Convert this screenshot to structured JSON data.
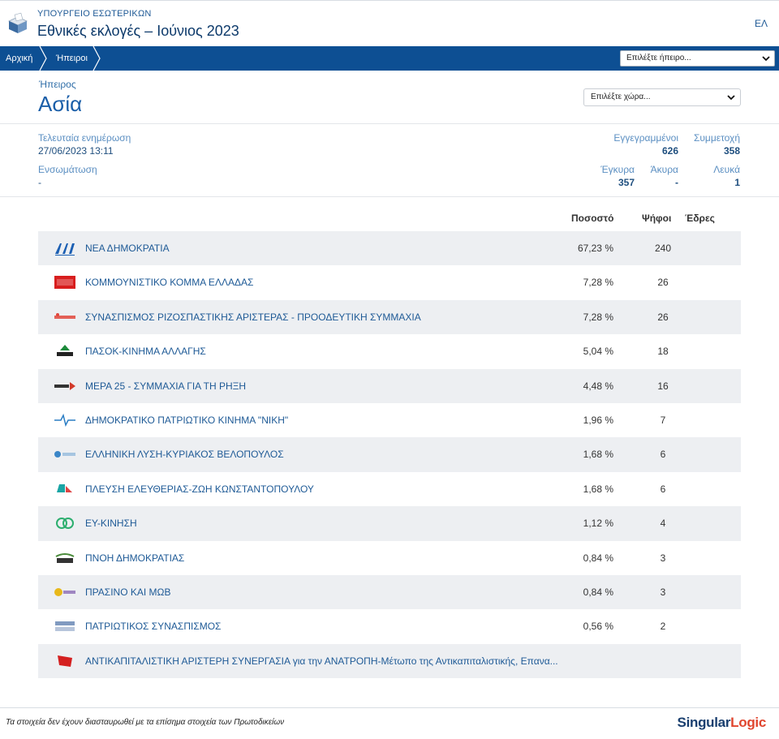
{
  "header": {
    "ministry": "ΥΠΟΥΡΓΕΙΟ ΕΣΩΤΕΡΙΚΩΝ",
    "title": "Εθνικές εκλογές – Ιούνιος 2023",
    "lang": "ΕΛ",
    "logo_icon": "ballot-box-icon"
  },
  "nav": {
    "crumbs": [
      "Αρχική",
      "Ήπειροι"
    ],
    "continent_select": "Επιλέξτε ήπειρο..."
  },
  "region": {
    "kicker": "Ήπειρος",
    "name": "Ασία",
    "country_select": "Επιλέξτε χώρα..."
  },
  "info": {
    "last_update_label": "Τελευταία ενημέρωση",
    "last_update_value": "27/06/2023 13:11",
    "integration_label": "Ενσωμάτωση",
    "integration_value": "-",
    "registered_label": "Εγγεγραμμένοι",
    "registered_value": "626",
    "turnout_label": "Συμμετοχή",
    "turnout_value": "358",
    "valid_label": "Έγκυρα",
    "valid_value": "357",
    "invalid_label": "Άκυρα",
    "invalid_value": "-",
    "blank_label": "Λευκά",
    "blank_value": "1"
  },
  "table": {
    "headers": {
      "percent": "Ποσοστό",
      "votes": "Ψήφοι",
      "seats": "Έδρες"
    },
    "rows": [
      {
        "name": "ΝΕΑ ΔΗΜΟΚΡΑΤΙΑ",
        "percent": "67,23 %",
        "votes": "240",
        "logo": "nd-logo-icon",
        "color": "#1b5fb3"
      },
      {
        "name": "ΚΟΜΜΟΥΝΙΣΤΙΚΟ ΚΟΜΜΑ ΕΛΛΑΔΑΣ",
        "percent": "7,28 %",
        "votes": "26",
        "logo": "kke-logo-icon",
        "color": "#d81e1e"
      },
      {
        "name": "ΣΥΝΑΣΠΙΣΜΟΣ ΡΙΖΟΣΠΑΣΤΙΚΗΣ ΑΡΙΣΤΕΡΑΣ - ΠΡΟΟΔΕΥΤΙΚΗ ΣΥΜΜΑΧΙΑ",
        "percent": "7,28 %",
        "votes": "26",
        "logo": "syriza-logo-icon",
        "color": "#e0463c"
      },
      {
        "name": "ΠΑΣΟΚ-ΚΙΝΗΜΑ ΑΛΛΑΓΗΣ",
        "percent": "5,04 %",
        "votes": "18",
        "logo": "pasok-logo-icon",
        "color": "#1d8a3a"
      },
      {
        "name": "ΜΕΡΑ 25 - ΣΥΜΜΑΧΙΑ ΓΙΑ ΤΗ ΡΗΞΗ",
        "percent": "4,48 %",
        "votes": "16",
        "logo": "mera25-logo-icon",
        "color": "#d23a2a"
      },
      {
        "name": "ΔΗΜΟΚΡΑΤΙΚΟ ΠΑΤΡΙΩΤΙΚΟ ΚΙΝΗΜΑ \"ΝΙΚΗ\"",
        "percent": "1,96 %",
        "votes": "7",
        "logo": "niki-logo-icon",
        "color": "#2a7dc4"
      },
      {
        "name": "ΕΛΛΗΝΙΚΗ ΛΥΣΗ-ΚΥΡΙΑΚΟΣ ΒΕΛΟΠΟΥΛΟΣ",
        "percent": "1,68 %",
        "votes": "6",
        "logo": "elliniki-lysi-logo-icon",
        "color": "#3b86c8"
      },
      {
        "name": "ΠΛΕΥΣΗ ΕΛΕΥΘΕΡΙΑΣ-ΖΩΗ ΚΩΝΣΤΑΝΤΟΠΟΥΛΟΥ",
        "percent": "1,68 %",
        "votes": "6",
        "logo": "plefsi-logo-icon",
        "color": "#1aa5a5"
      },
      {
        "name": "ΕΥ-ΚΙΝΗΣΗ",
        "percent": "1,12 %",
        "votes": "4",
        "logo": "ey-kinisi-logo-icon",
        "color": "#2cae6e"
      },
      {
        "name": "ΠΝΟΗ ΔΗΜΟΚΡΑΤΙΑΣ",
        "percent": "0,84 %",
        "votes": "3",
        "logo": "pnoi-logo-icon",
        "color": "#4a8b3a"
      },
      {
        "name": "ΠΡΑΣΙΝΟ ΚΑΙ ΜΩΒ",
        "percent": "0,84 %",
        "votes": "3",
        "logo": "prasino-mov-logo-icon",
        "color": "#e8b81a"
      },
      {
        "name": "ΠΑΤΡΙΩΤΙΚΟΣ ΣΥΝΑΣΠΙΣΜΟΣ",
        "percent": "0,56 %",
        "votes": "2",
        "logo": "patriotikos-logo-icon",
        "color": "#4a6fa5"
      },
      {
        "name": "ΑΝΤΙΚΑΠΙΤΑΛΙΣΤΙΚΗ ΑΡΙΣΤΕΡΗ ΣΥΝΕΡΓΑΣΙΑ για την ΑΝΑΤΡΟΠΗ-Μέτωπο της Αντικαπιταλιστικής, Επανα...",
        "percent": "",
        "votes": "",
        "logo": "antarsya-logo-icon",
        "color": "#d42020"
      }
    ]
  },
  "footer": {
    "note": "Τα στοιχεία δεν έχουν διασταυρωθεί με τα επίσημα στοιχεία των Πρωτοδικείων",
    "brand_main": "Singular",
    "brand_accent": "Logic"
  }
}
